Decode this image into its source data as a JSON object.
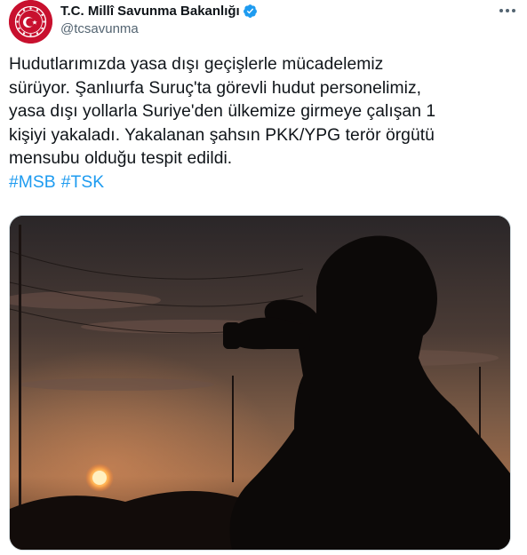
{
  "account": {
    "display_name": "T.C. Millî Savunma Bakanlığı",
    "handle": "@tcsavunma",
    "verified": true,
    "verified_icon": "verified-badge-icon",
    "avatar_icon": "msb-emblem-icon",
    "more_icon": "more-options-icon"
  },
  "tweet": {
    "text_lines": [
      "Hudutlarımızda yasa dışı geçişlerle mücadelemiz",
      "sürüyor. Şanlıurfa Suruç'ta görevli hudut personelimiz,",
      "yasa dışı yollarla Suriye'den ülkemize girmeye çalışan 1",
      "kişiyi yakaladı. Yakalanan şahsın PKK/YPG terör örgütü",
      "mensubu olduğu tespit edildi."
    ],
    "hashtags": [
      "#MSB",
      "#TSK"
    ]
  },
  "media": {
    "description_icon": "soldier-silhouette-photo"
  },
  "colors": {
    "link": "#1d9bf0",
    "verified": "#1d9bf0",
    "avatar_bg": "#c8102e",
    "secondary_text": "#536471"
  }
}
